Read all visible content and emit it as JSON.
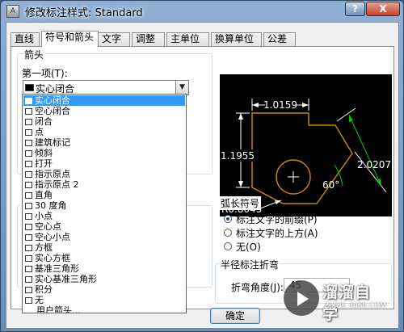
{
  "window": {
    "title": "修改标注样式: Standard",
    "help_label": "?",
    "close_label": "X"
  },
  "tabs": [
    {
      "label": "直线"
    },
    {
      "label": "符号和箭头"
    },
    {
      "label": "文字"
    },
    {
      "label": "调整"
    },
    {
      "label": "主单位"
    },
    {
      "label": "换算单位"
    },
    {
      "label": "公差"
    }
  ],
  "arrowheads": {
    "group_title": "箭头",
    "first_label": "第一项(T):",
    "first_value": "实心闭合",
    "options": [
      "实心闭合",
      "空心闭合",
      "闭合",
      "点",
      "建筑标记",
      "倾斜",
      "打开",
      "指示原点",
      "指示原点 2",
      "直角",
      "30 度角",
      "小点",
      "空心点",
      "空心小点",
      "方框",
      "实心方框",
      "基准三角形",
      "实心基准三角形",
      "积分",
      "无",
      "用户箭头..."
    ],
    "selected_index": 0
  },
  "preview": {
    "dim_top": "1.0159",
    "dim_left": "1.1955",
    "dim_right": "2.0207",
    "dim_angle": "60°",
    "dim_radius": "R0.8045"
  },
  "arc_length": {
    "group_title": "弧长符号",
    "options": [
      {
        "label": "标注文字的前缀(P)",
        "checked": true
      },
      {
        "label": "标注文字的上方(A)",
        "checked": false
      },
      {
        "label": "无(O)",
        "checked": false
      }
    ]
  },
  "radius_jog": {
    "group_title": "半径标注折弯",
    "angle_label": "折弯角度(J):",
    "angle_value": "45"
  },
  "buttons": {
    "ok_label": "确定"
  },
  "watermark": {
    "brand": "溜溜自学",
    "url": "ZIXUE.3066.COM"
  },
  "colors": {
    "preview_line": "#c08a00",
    "preview_dim": "#ffffff",
    "preview_arrow": "#00c800",
    "selection": "#3399ff"
  }
}
